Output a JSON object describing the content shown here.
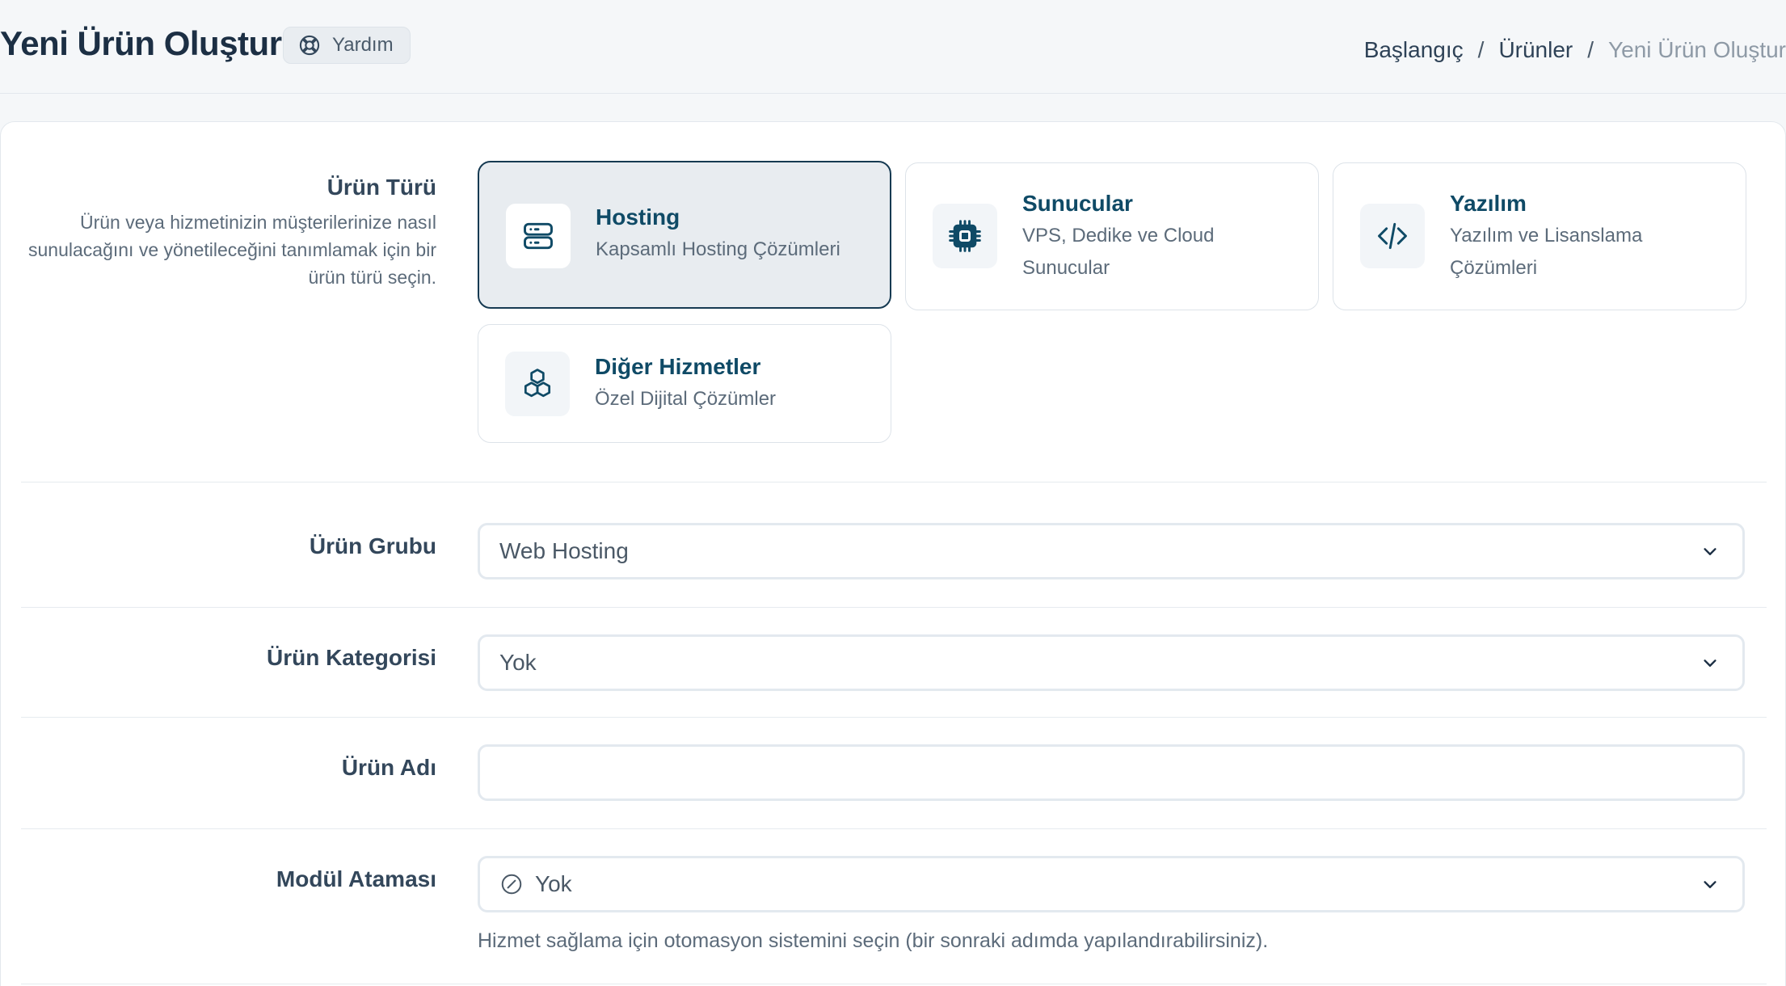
{
  "header": {
    "title": "Yeni Ürün Oluştur",
    "help_label": "Yardım",
    "breadcrumb": {
      "home": "Başlangıç",
      "products": "Ürünler",
      "current": "Yeni Ürün Oluştur",
      "separator": "/"
    }
  },
  "product_type": {
    "label": "Ürün Türü",
    "description": "Ürün veya hizmetinizin müşterilerinize nasıl sunulacağını ve yönetileceğini tanımlamak için bir ürün türü seçin.",
    "options": [
      {
        "title": "Hosting",
        "subtitle": "Kapsamlı Hosting Çözümleri",
        "icon": "server-icon",
        "selected": true
      },
      {
        "title": "Sunucular",
        "subtitle": "VPS, Dedike ve Cloud Sunucular",
        "icon": "cpu-chip-icon",
        "selected": false
      },
      {
        "title": "Yazılım",
        "subtitle": "Yazılım ve Lisanslama Çözümleri",
        "icon": "code-icon",
        "selected": false
      },
      {
        "title": "Diğer Hizmetler",
        "subtitle": "Özel Dijital Çözümler",
        "icon": "cubes-icon",
        "selected": false
      }
    ]
  },
  "product_group": {
    "label": "Ürün Grubu",
    "value": "Web Hosting"
  },
  "product_category": {
    "label": "Ürün Kategorisi",
    "value": "Yok"
  },
  "product_name": {
    "label": "Ürün Adı",
    "value": "",
    "placeholder": ""
  },
  "module": {
    "label": "Modül Ataması",
    "value": "Yok",
    "hint": "Hizmet sağlama için otomasyon sistemini seçin (bir sonraki adımda yapılandırabilirsiniz)."
  },
  "colors": {
    "accent": "#0f4a66",
    "selected_border": "#163a52",
    "selected_bg": "#e8ecf0",
    "background": "#f5f7f9"
  }
}
